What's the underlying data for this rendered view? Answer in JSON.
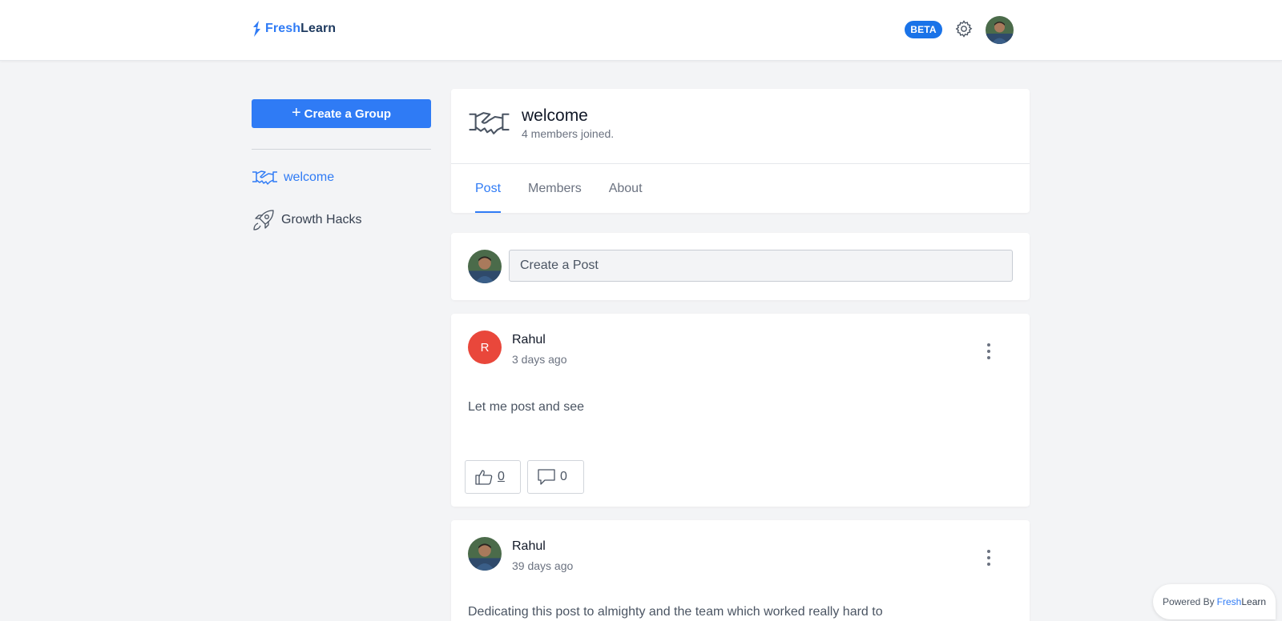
{
  "header": {
    "logo_fresh": "Fresh",
    "logo_learn": "Learn",
    "beta_badge": "BETA"
  },
  "sidebar": {
    "create_button": "Create a Group",
    "items": [
      {
        "label": "welcome",
        "icon": "handshake-icon",
        "active": true
      },
      {
        "label": "Growth Hacks",
        "icon": "rocket-icon",
        "active": false
      }
    ]
  },
  "group": {
    "title": "welcome",
    "subtitle": "4 members joined.",
    "tabs": [
      {
        "label": "Post",
        "active": true
      },
      {
        "label": "Members",
        "active": false
      },
      {
        "label": "About",
        "active": false
      }
    ]
  },
  "compose": {
    "placeholder": "Create a Post"
  },
  "posts": [
    {
      "author": "Rahul",
      "avatar_letter": "R",
      "time": "3 days ago",
      "body": "Let me post and see",
      "likes": "0",
      "comments": "0"
    },
    {
      "author": "Rahul",
      "time": "39 days ago",
      "body": "Dedicating this post to almighty and the team which worked really hard to"
    }
  ],
  "footer": {
    "powered_prefix": "Powered By",
    "brand_fresh": "Fresh",
    "brand_learn": "Learn"
  },
  "colors": {
    "accent": "#2f7bf5",
    "avatar_letter_bg": "#e9473b"
  }
}
